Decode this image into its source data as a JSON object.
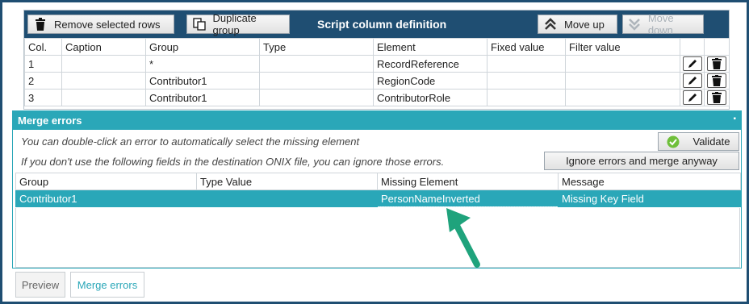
{
  "toolbar": {
    "remove_label": "Remove selected rows",
    "duplicate_label": "Duplicate group",
    "title": "Script column definition",
    "move_up_label": "Move up",
    "move_down_label": "Move down"
  },
  "top_table": {
    "headers": [
      "Col.",
      "Caption",
      "Group",
      "Type",
      "Element",
      "Fixed value",
      "Filter value"
    ],
    "rows": [
      {
        "col": "1",
        "caption": "",
        "group": "*",
        "type": "",
        "element": "RecordReference",
        "fixed": "",
        "filter": ""
      },
      {
        "col": "2",
        "caption": "",
        "group": "Contributor1",
        "type": "",
        "element": "RegionCode",
        "fixed": "",
        "filter": ""
      },
      {
        "col": "3",
        "caption": "",
        "group": "Contributor1",
        "type": "",
        "element": "ContributorRole",
        "fixed": "",
        "filter": ""
      }
    ]
  },
  "merge": {
    "title": "Merge errors",
    "pin": "▪",
    "info1": "You can double-click an error to automatically select the missing element",
    "info2": "If you don't use the following fields in the destination ONIX file, you can ignore those errors.",
    "validate_label": "Validate",
    "ignore_label": "Ignore errors and merge anyway",
    "headers": [
      "Group",
      "Type Value",
      "Missing Element",
      "Message"
    ],
    "rows": [
      {
        "group": "Contributor1",
        "type_value": "",
        "missing": "PersonNameInverted",
        "message": "Missing Key Field"
      }
    ]
  },
  "tabs": {
    "preview": "Preview",
    "merge_errors": "Merge errors"
  },
  "colors": {
    "toolbar_bg": "#1f4e72",
    "accent": "#2aa7b8",
    "arrow": "#1fa37c"
  }
}
